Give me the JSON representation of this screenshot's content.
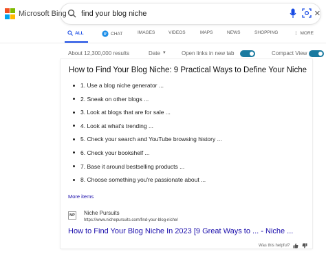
{
  "logo": {
    "text": "Microsoft Bing",
    "colors": [
      "#f25022",
      "#7fba00",
      "#00a4ef",
      "#ffb900"
    ]
  },
  "search": {
    "query": "find your blog niche",
    "clear_icon": "close-icon",
    "mic_icon": "mic-icon",
    "visual_icon": "visual-search-icon"
  },
  "tabs": [
    {
      "label": "ALL",
      "icon": "search-icon",
      "active": true
    },
    {
      "label": "CHAT",
      "icon": "chat-icon"
    },
    {
      "label": "IMAGES"
    },
    {
      "label": "VIDEOS"
    },
    {
      "label": "MAPS"
    },
    {
      "label": "NEWS"
    },
    {
      "label": "SHOPPING"
    },
    {
      "label": "MORE",
      "icon": "more-icon"
    }
  ],
  "toolbar": {
    "results_count": "About 12,300,000 results",
    "date_label": "Date",
    "open_links_label": "Open links in new tab",
    "open_links_on": true,
    "compact_view_label": "Compact View",
    "compact_view_on": true
  },
  "answer": {
    "title": "How to Find Your Blog Niche: 9 Practical Ways to Define Your Niche",
    "items": [
      "1. Use a blog niche generator ...",
      "2. Sneak on other blogs ...",
      "3. Look at blogs that are for sale ...",
      "4. Look at what's trending ...",
      "5. Check your search and YouTube browsing history ...",
      "6. Check your bookshelf ...",
      "7. Base it around bestselling products ...",
      "8. Choose something you're passionate about ..."
    ],
    "more_items": "More items",
    "source_icon_text": "NP",
    "source_name": "Niche Pursuits",
    "source_url": "https://www.nichepursuits.com/find-your-blog-niche/",
    "result_title": "How to Find Your Blog Niche In 2023 [9 Great Ways to ... - Niche ..."
  },
  "feedback": {
    "label": "Was this helpful?"
  },
  "colors": {
    "accent": "#174ae4",
    "link": "#1a0dab",
    "toggle": "#1a7aa0"
  }
}
